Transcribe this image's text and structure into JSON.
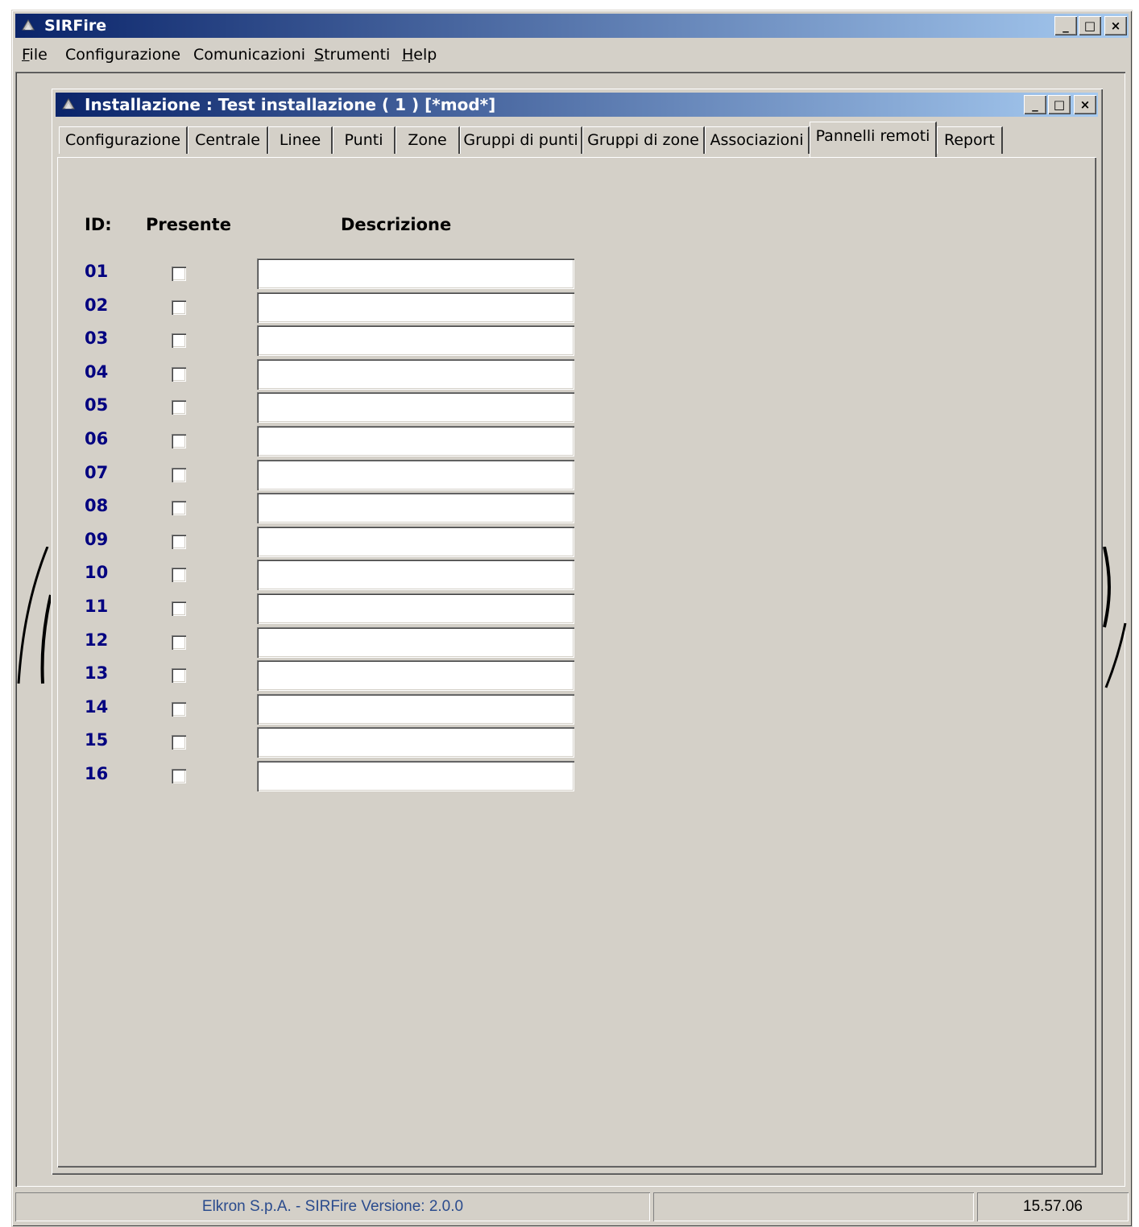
{
  "app": {
    "title": "SIRFire",
    "window_buttons": {
      "minimize": "_",
      "maximize": "□",
      "close": "×"
    }
  },
  "menu": [
    {
      "label": "File",
      "accel": "F",
      "rest": "ile"
    },
    {
      "label": "Configurazione"
    },
    {
      "label": "Comunicazioni"
    },
    {
      "label": "Strumenti",
      "accel": "S",
      "rest": "trumenti"
    },
    {
      "label": "Help",
      "accel": "H",
      "rest": "elp"
    }
  ],
  "child": {
    "title": "Installazione : Test installazione  ( 1 )  [*mod*]"
  },
  "tabs": [
    "Configurazione",
    "Centrale",
    "Linee",
    "Punti",
    "Zone",
    "Gruppi di punti",
    "Gruppi di zone",
    "Associazioni",
    "Pannelli remoti",
    "Report"
  ],
  "active_tab": "Pannelli remoti",
  "panel": {
    "headers": {
      "id": "ID:",
      "presente": "Presente",
      "descrizione": "Descrizione"
    },
    "rows": [
      {
        "id": "01",
        "presente": false,
        "descrizione": ""
      },
      {
        "id": "02",
        "presente": false,
        "descrizione": ""
      },
      {
        "id": "03",
        "presente": false,
        "descrizione": ""
      },
      {
        "id": "04",
        "presente": false,
        "descrizione": ""
      },
      {
        "id": "05",
        "presente": false,
        "descrizione": ""
      },
      {
        "id": "06",
        "presente": false,
        "descrizione": ""
      },
      {
        "id": "07",
        "presente": false,
        "descrizione": ""
      },
      {
        "id": "08",
        "presente": false,
        "descrizione": ""
      },
      {
        "id": "09",
        "presente": false,
        "descrizione": ""
      },
      {
        "id": "10",
        "presente": false,
        "descrizione": ""
      },
      {
        "id": "11",
        "presente": false,
        "descrizione": ""
      },
      {
        "id": "12",
        "presente": false,
        "descrizione": ""
      },
      {
        "id": "13",
        "presente": false,
        "descrizione": ""
      },
      {
        "id": "14",
        "presente": false,
        "descrizione": ""
      },
      {
        "id": "15",
        "presente": false,
        "descrizione": ""
      },
      {
        "id": "16",
        "presente": false,
        "descrizione": ""
      }
    ]
  },
  "status": {
    "text": "Elkron S.p.A.  -  SIRFire  Versione: 2.0.0",
    "middle": "",
    "time": "15.57.06"
  },
  "colors": {
    "face": "#d4d0c8",
    "title_start": "#0a246a",
    "title_end": "#a6caf0",
    "id_text": "#000080",
    "status_text": "#2a4b8d"
  }
}
